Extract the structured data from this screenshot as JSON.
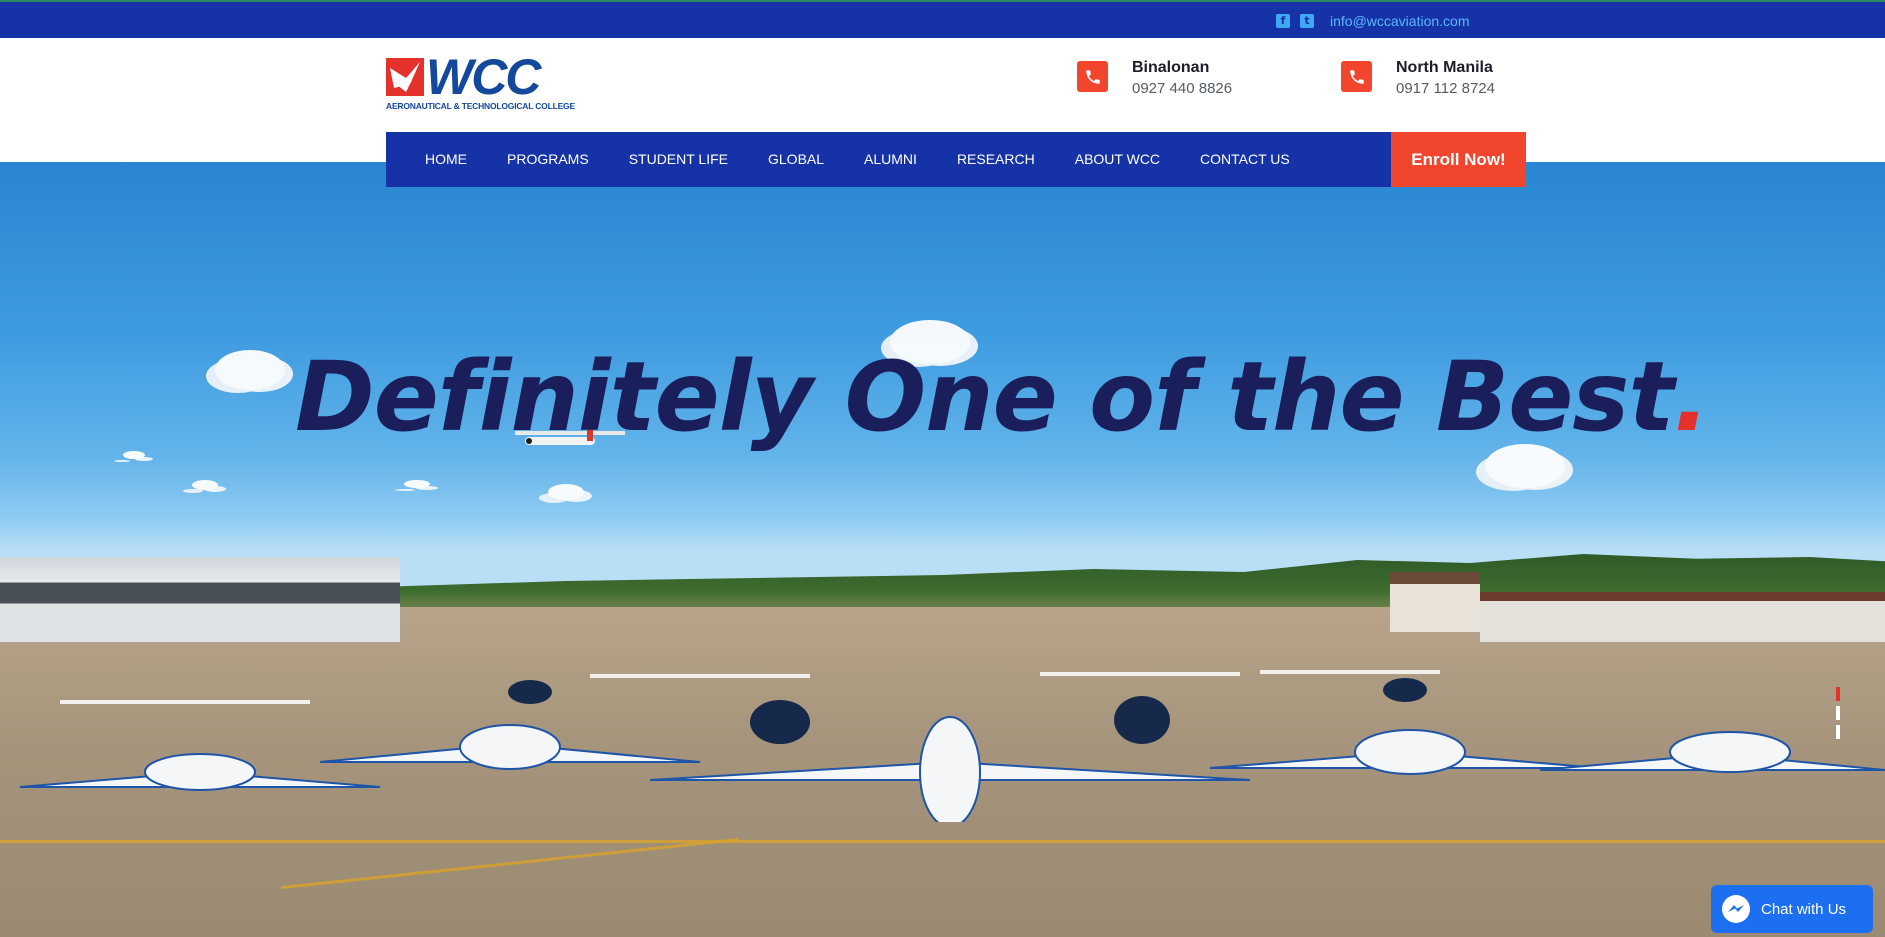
{
  "topbar": {
    "social": [
      {
        "name": "facebook-icon",
        "glyph": "f"
      },
      {
        "name": "twitter-icon",
        "glyph": "t"
      }
    ],
    "email": "info@wccaviation.com"
  },
  "logo": {
    "wordmark": "WCC",
    "subtitle": "AERONAUTICAL & TECHNOLOGICAL COLLEGE"
  },
  "contacts": [
    {
      "city": "Binalonan",
      "phone": "0927 440 8826",
      "icon": "phone-icon"
    },
    {
      "city": "North Manila",
      "phone": "0917 112 8724",
      "icon": "phone-icon"
    }
  ],
  "nav": {
    "items": [
      "HOME",
      "PROGRAMS",
      "STUDENT LIFE",
      "GLOBAL",
      "ALUMNI",
      "RESEARCH",
      "ABOUT WCC",
      "CONTACT US"
    ],
    "enroll_label": "Enroll Now!"
  },
  "hero": {
    "headline": "Definitely One of the Best",
    "headline_dot": ".",
    "slides": 5,
    "active_slide": 1
  },
  "chat": {
    "label": "Chat with Us",
    "icon": "messenger-icon"
  },
  "colors": {
    "brand_blue": "#1532a6",
    "accent_red": "#f2452e",
    "headline_navy": "#1a1f5c",
    "chat_blue": "#1d6ff2"
  }
}
